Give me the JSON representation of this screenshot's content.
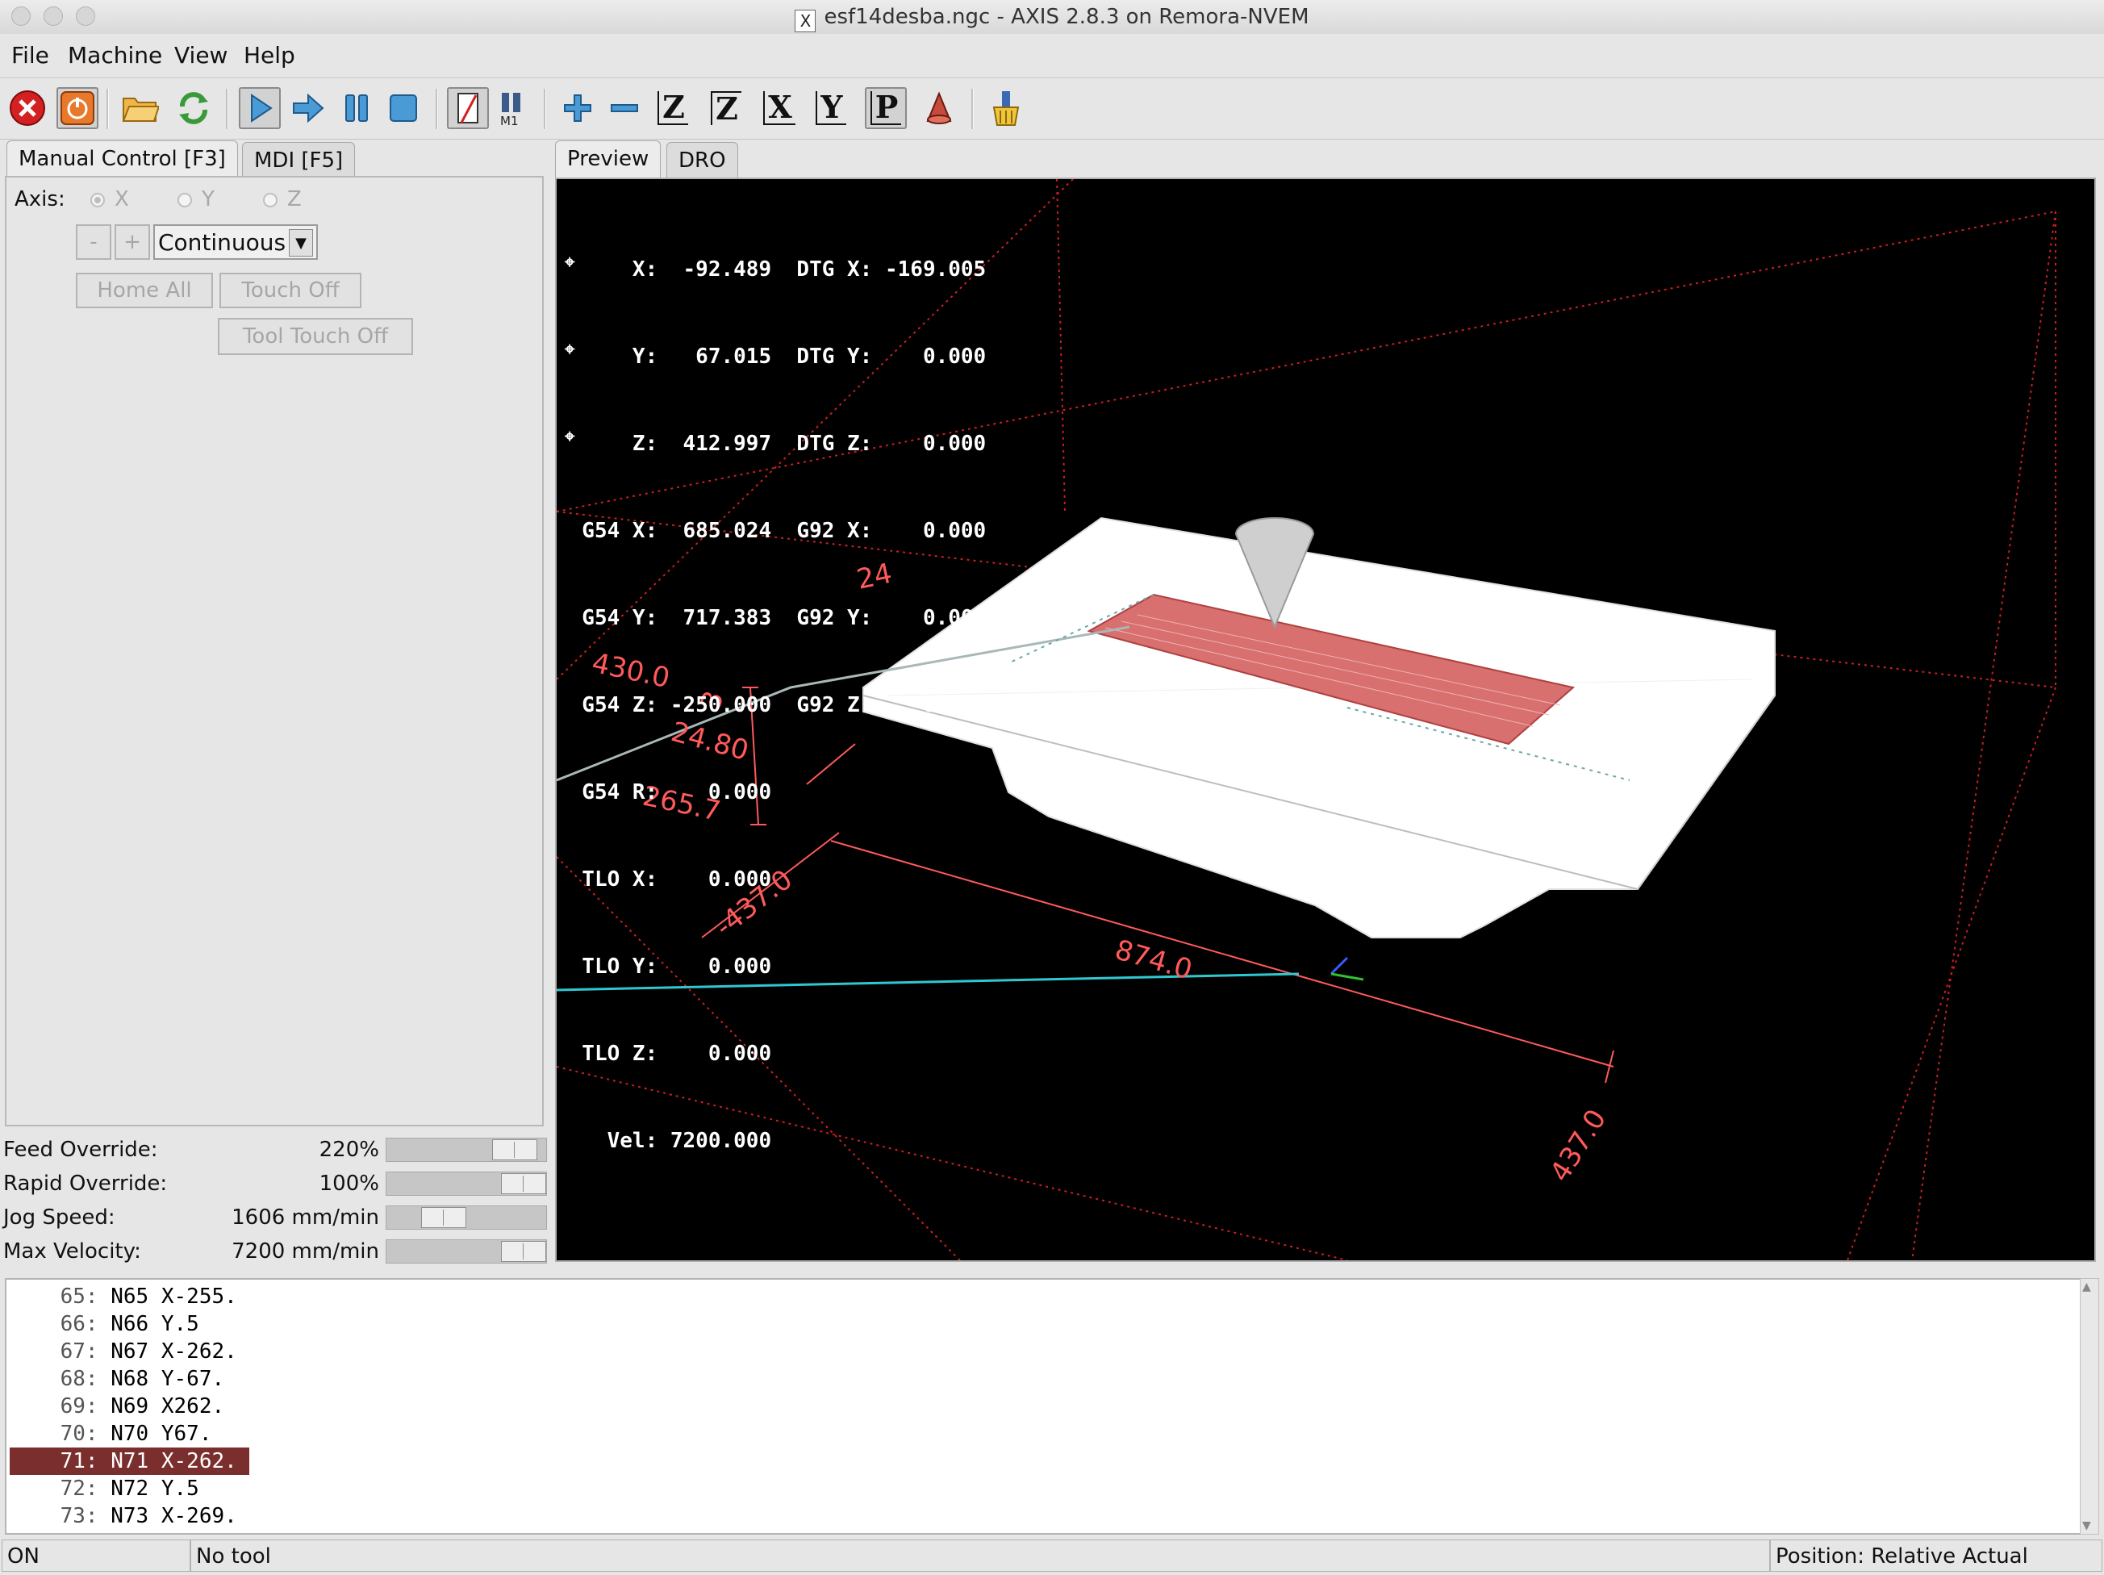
{
  "window": {
    "title": "esf14desba.ngc - AXIS 2.8.3 on Remora-NVEM",
    "x_icon": "X"
  },
  "menu": [
    "File",
    "Machine",
    "View",
    "Help"
  ],
  "toolbar": {
    "icons": [
      "estop-icon",
      "machine-power-icon",
      "open-file-icon",
      "reload-icon",
      "run-icon",
      "step-icon",
      "pause-icon",
      "stop-icon",
      "block-delete-icon",
      "optional-stop-icon",
      "zoom-in-icon",
      "zoom-out-icon",
      "view-z-icon",
      "view-z2-icon",
      "view-x-icon",
      "view-y-icon",
      "view-p-icon",
      "rotate-view-icon",
      "clear-backplot-icon"
    ],
    "optional_stop_label": "M1",
    "view_labels": [
      "Z",
      "Z",
      "X",
      "Y",
      "P"
    ]
  },
  "left_tabs": [
    "Manual Control [F3]",
    "MDI [F5]"
  ],
  "manual": {
    "axis_label": "Axis:",
    "axes": [
      "X",
      "Y",
      "Z"
    ],
    "selected_axis": "X",
    "jog_minus": "-",
    "jog_plus": "+",
    "jog_mode": "Continuous",
    "home_all": "Home All",
    "touch_off": "Touch Off",
    "tool_touch_off": "Tool Touch Off"
  },
  "overrides": [
    {
      "label": "Feed Override:",
      "value": "220",
      "unit": "%",
      "fraction": 0.92
    },
    {
      "label": "Rapid Override:",
      "value": "100",
      "unit": "%",
      "fraction": 1.0
    },
    {
      "label": "Jog Speed:",
      "value": "1606 mm/min",
      "unit": "",
      "fraction": 0.3
    },
    {
      "label": "Max Velocity:",
      "value": "7200 mm/min",
      "unit": "",
      "fraction": 1.0
    }
  ],
  "right_tabs": [
    "Preview",
    "DRO"
  ],
  "dro": [
    "      X:  -92.489  DTG X: -169.005",
    "      Y:   67.015  DTG Y:    0.000",
    "      Z:  412.997  DTG Z:    0.000",
    "  G54 X:  685.024  G92 X:    0.000",
    "  G54 Y:  717.383  G92 Y:    0.000",
    "  G54 Z: -250.000  G92 Z:    0.000",
    "  G54 R:    0.000",
    "  TLO X:    0.000",
    "  TLO Y:    0.000",
    "  TLO Z:    0.000",
    "    Vel: 7200.000"
  ],
  "preview_labels": {
    "dim_430": "430.0",
    "dim_3": "3",
    "dim_24": "24",
    "dim_2480": "24.80",
    "dim_2657": "265.7",
    "dim_neg437": "-437.0",
    "dim_874": "874.0",
    "dim_437": "437.0"
  },
  "gcode": [
    {
      "num": "65:",
      "code": "N65 X-255."
    },
    {
      "num": "66:",
      "code": "N66 Y.5"
    },
    {
      "num": "67:",
      "code": "N67 X-262."
    },
    {
      "num": "68:",
      "code": "N68 Y-67."
    },
    {
      "num": "69:",
      "code": "N69 X262."
    },
    {
      "num": "70:",
      "code": "N70 Y67."
    },
    {
      "num": "71:",
      "code": "N71 X-262."
    },
    {
      "num": "72:",
      "code": "N72 Y.5"
    },
    {
      "num": "73:",
      "code": "N73 X-269."
    }
  ],
  "current_line": "71:",
  "status": {
    "machine": "ON",
    "tool": "No tool",
    "position": "Position: Relative Actual"
  },
  "colors": {
    "estop": "#d42020",
    "highlight": "#7a2e2e",
    "dro_text": "#ffffff",
    "dimension": "#ff5a5a",
    "path": "#e07a7a"
  }
}
